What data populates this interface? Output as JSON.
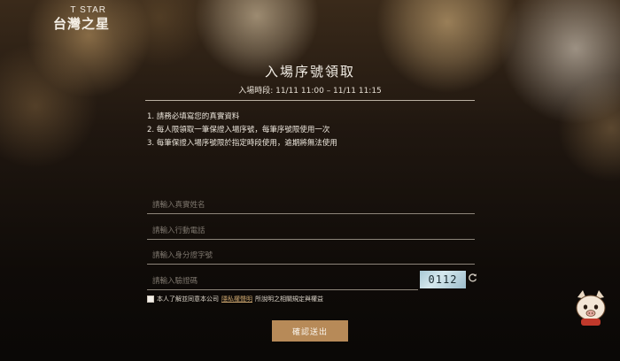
{
  "brand": {
    "name_en": "T STAR",
    "name_zh": "台灣之星"
  },
  "page": {
    "title": "入場序號領取",
    "subtitle": "入場時段: 11/11 11:00 – 11/11 11:15"
  },
  "rules": [
    "1. 請務必填寫您的真實資料",
    "2. 每人限領取一筆保證入場序號，每筆序號限使用一次",
    "3. 每筆保證入場序號限於指定時段使用，逾期將無法使用"
  ],
  "form": {
    "name_placeholder": "請輸入真實姓名",
    "phone_placeholder": "請輸入行動電話",
    "id_placeholder": "請輸入身分證字號",
    "captcha_placeholder": "請輸入驗證碼",
    "captcha_code": "0112",
    "agree_prefix": "本人了解並同意本公司",
    "agree_link": "隱私權聲明",
    "agree_suffix": "所說明之相關規定與權益",
    "submit_label": "確認送出"
  },
  "icons": {
    "refresh": "refresh-icon",
    "mascot": "mascot-icon"
  },
  "colors": {
    "accent": "#b78a58",
    "link": "#c9a36d",
    "background": "#120d08"
  }
}
